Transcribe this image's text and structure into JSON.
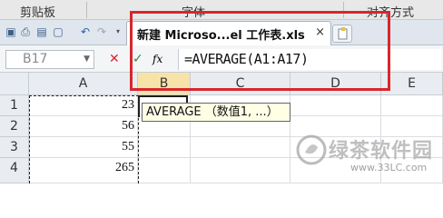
{
  "ribbon": {
    "groups": [
      "剪贴板",
      "字体",
      "对齐方式"
    ]
  },
  "quick_access": {
    "icons": [
      "save-icon",
      "print-icon",
      "print-preview-icon",
      "undo-icon",
      "redo-icon"
    ]
  },
  "tabs": {
    "active_title": "新建 Microso...el 工作表.xls",
    "close_symbol": "×"
  },
  "formula_bar": {
    "name_box": "B17",
    "cancel_symbol": "✕",
    "confirm_symbol": "✓",
    "fx_label": "fx",
    "formula": "=AVERAGE(A1:A17)"
  },
  "grid": {
    "columns": [
      "A",
      "B",
      "C",
      "D",
      "E"
    ],
    "selected_column": "B",
    "rows": [
      {
        "num": "1",
        "a": "23"
      },
      {
        "num": "2",
        "a": "56"
      },
      {
        "num": "3",
        "a": "55"
      },
      {
        "num": "4",
        "a": "265"
      }
    ]
  },
  "tooltip": {
    "text": "AVERAGE （数值1, ...）"
  },
  "watermark": {
    "text": "绿茶软件园",
    "url": "www.33LC.com"
  },
  "colors": {
    "highlight": "#d8262d",
    "selected_header": "#f7e3a8",
    "tooltip_bg": "#ffffe6"
  }
}
